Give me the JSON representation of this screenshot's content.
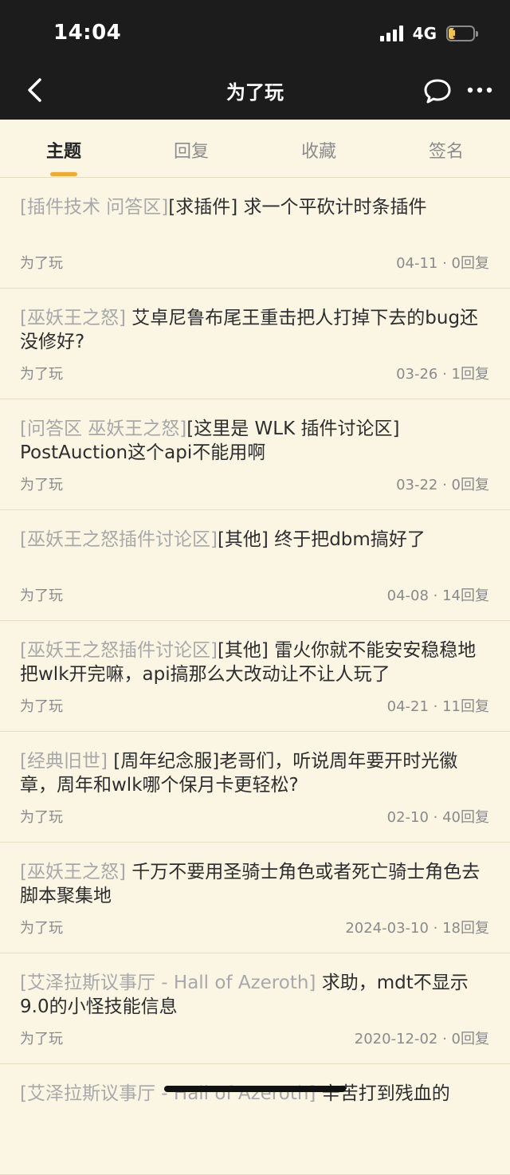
{
  "status": {
    "time": "14:04",
    "network": "4G",
    "battery": "11",
    "battery_level": 0.11
  },
  "nav": {
    "title": "为了玩",
    "back_icon": "chevron-left-icon",
    "chat_icon": "chat-bubble-icon",
    "more_icon": "more-dots-icon"
  },
  "tabs": [
    {
      "label": "主题",
      "active": true
    },
    {
      "label": "回复",
      "active": false
    },
    {
      "label": "收藏",
      "active": false
    },
    {
      "label": "签名",
      "active": false
    }
  ],
  "accent_color": "#f0a830",
  "posts": [
    {
      "forum": "[插件技术 问答区]",
      "title": "[求插件] 求一个平砍计时条插件",
      "author": "为了玩",
      "meta": "04-11 · 0回复"
    },
    {
      "forum": "[巫妖王之怒]",
      "title": " 艾卓尼鲁布尾王重击把人打掉下去的bug还没修好?",
      "author": "为了玩",
      "meta": "03-26 · 1回复"
    },
    {
      "forum": "[问答区 巫妖王之怒]",
      "title": "[这里是 WLK 插件讨论区] PostAuction这个api不能用啊",
      "author": "为了玩",
      "meta": "03-22 · 0回复"
    },
    {
      "forum": "[巫妖王之怒插件讨论区]",
      "title": "[其他] 终于把dbm搞好了",
      "author": "为了玩",
      "meta": "04-08 · 14回复"
    },
    {
      "forum": "[巫妖王之怒插件讨论区]",
      "title": "[其他] 雷火你就不能安安稳稳地把wlk开完嘛，api搞那么大改动让不让人玩了",
      "author": "为了玩",
      "meta": "04-21 · 11回复"
    },
    {
      "forum": "[经典旧世]",
      "title": " [周年纪念服]老哥们，听说周年要开时光徽章，周年和wlk哪个保月卡更轻松?",
      "author": "为了玩",
      "meta": "02-10 · 40回复"
    },
    {
      "forum": "[巫妖王之怒]",
      "title": " 千万不要用圣骑士角色或者死亡骑士角色去脚本聚集地",
      "author": "为了玩",
      "meta": "2024-03-10 · 18回复"
    },
    {
      "forum": "[艾泽拉斯议事厅 - Hall of Azeroth]",
      "title": " 求助，mdt不显示9.0的小怪技能信息",
      "author": "为了玩",
      "meta": "2020-12-02 · 0回复"
    },
    {
      "forum": "[艾泽拉斯议事厅 - Hall of Azeroth]",
      "title": " 辛苦打到残血的",
      "author": "",
      "meta": ""
    }
  ]
}
